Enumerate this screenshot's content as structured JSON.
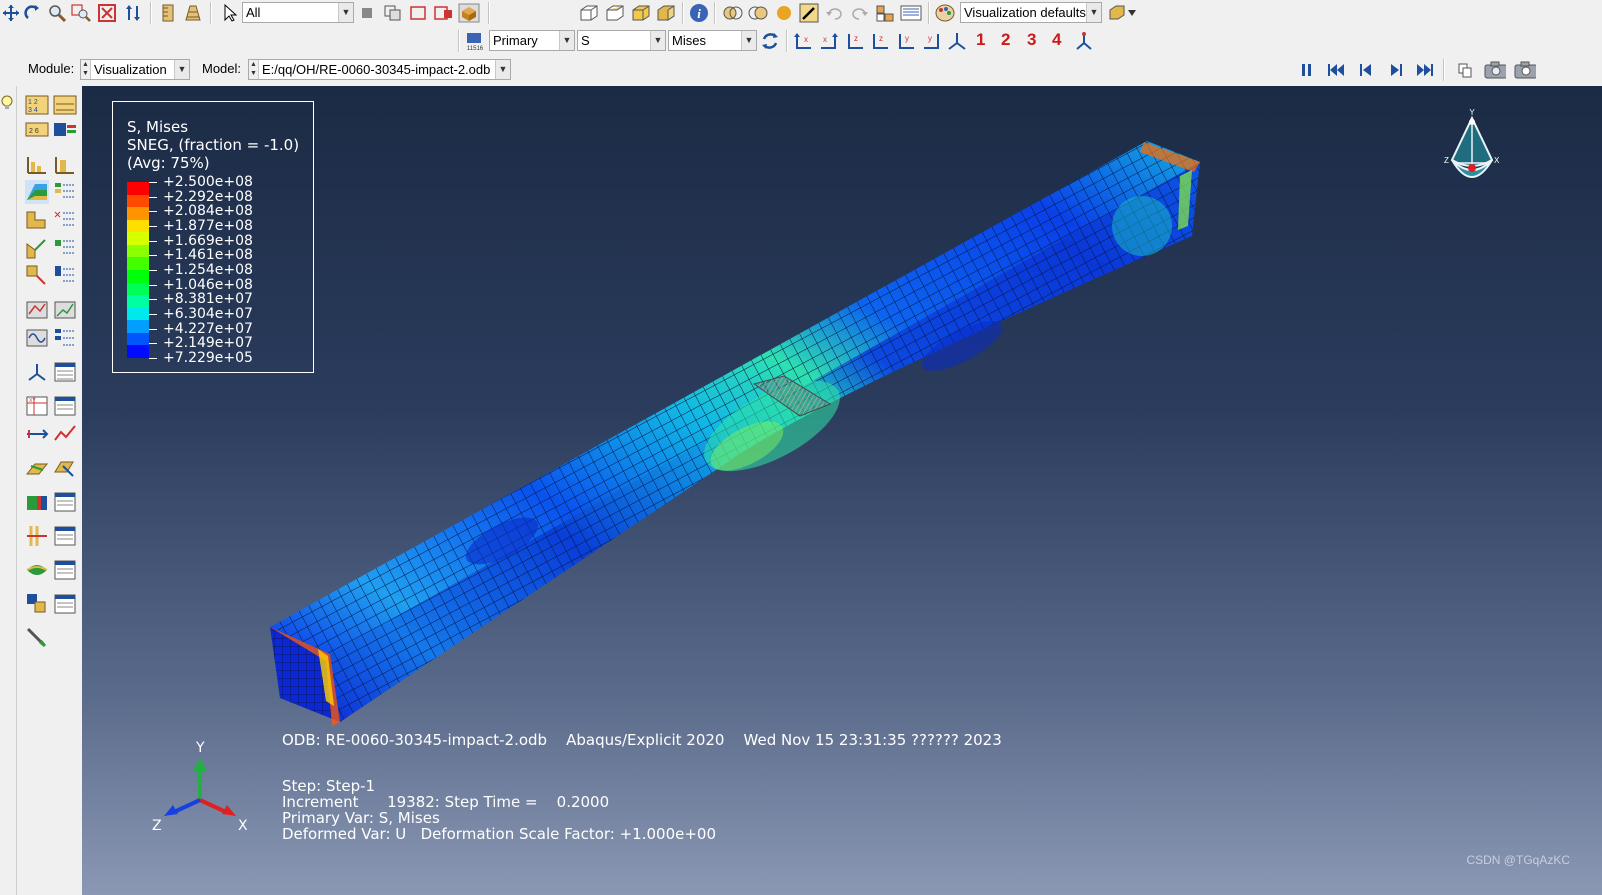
{
  "toolbar1": {
    "selection_filter": "All",
    "render_style": "Visualization defaults"
  },
  "toolbar2": {
    "step_selector": "Primary",
    "output_variable": "S",
    "invariant": "Mises",
    "view_numbers": [
      "1",
      "2",
      "3",
      "4"
    ]
  },
  "context": {
    "module_label": "Module:",
    "module_value": "Visualization",
    "model_label": "Model:",
    "model_value": "E:/qq/OH/RE-0060-30345-impact-2.odb"
  },
  "legend": {
    "title": "S, Mises",
    "subtitle": "SNEG, (fraction = -1.0)",
    "averaging": "(Avg: 75%)",
    "values": [
      "+2.500e+08",
      "+2.292e+08",
      "+2.084e+08",
      "+1.877e+08",
      "+1.669e+08",
      "+1.461e+08",
      "+1.254e+08",
      "+1.046e+08",
      "+8.381e+07",
      "+6.304e+07",
      "+4.227e+07",
      "+2.149e+07",
      "+7.229e+05"
    ],
    "colors": [
      "#ff0000",
      "#ff4a00",
      "#ff9400",
      "#ffdf00",
      "#d6ff00",
      "#8cff00",
      "#42ff00",
      "#00ff0b",
      "#00ff55",
      "#00ffa0",
      "#00e9ea",
      "#009fff",
      "#0055ff",
      "#000bff"
    ]
  },
  "viewport": {
    "odb_line": "ODB: RE-0060-30345-impact-2.odb    Abaqus/Explicit 2020    Wed Nov 15 23:31:35 ?????? 2023",
    "step_line": "Step: Step-1",
    "increment_line": "Increment      19382: Step Time =    0.2000",
    "primary_var_line": "Primary Var: S, Mises",
    "deformed_var_line": "Deformed Var: U   Deformation Scale Factor: +1.000e+00",
    "triad": {
      "y": "Y",
      "z": "Z",
      "x": "X"
    },
    "view_cube": {
      "y": "Y",
      "z": "Z",
      "x": "X"
    },
    "watermark": "CSDN @TGqAzKC"
  }
}
